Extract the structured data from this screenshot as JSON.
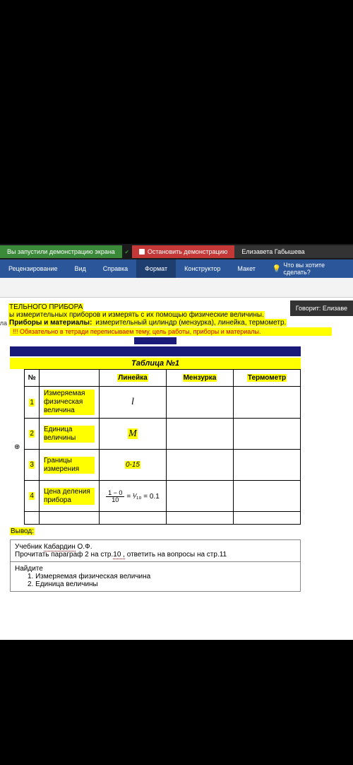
{
  "screenShare": {
    "running": "Вы запустили демонстрацию экрана",
    "stop": "Остановить демонстрацию",
    "user": "Елизавета Габышева"
  },
  "ribbon": {
    "review": "Рецензирование",
    "view": "Вид",
    "help": "Справка",
    "format": "Формат",
    "designer": "Конструктор",
    "layout": "Макет",
    "tellme": "Что вы хотите сделать?"
  },
  "speaking": "Говорит: Елизаве",
  "doc": {
    "partialTitle": "ТЕЛЬНОГО ПРИБОРА",
    "goalLine": "ы измерительных приборов и измерять с их помощью физические величины.",
    "sideFormula": "ула",
    "instrumentsLabel": "Приборы и материалы:",
    "instrumentsText": " измерительный цилиндр (мензурка), линейка, термометр.",
    "redNote": "!!! Обязательно в тетради переписываем тему, цель работы, приборы и материалы.",
    "tableTitle": "Таблица №1",
    "headers": {
      "num": "№",
      "blank": "",
      "ruler": "Линейка",
      "beaker": "Мензурка",
      "thermo": "Термометр"
    },
    "rows": [
      {
        "n": "1",
        "label": "Измеряемая физическая величина",
        "ruler": "l"
      },
      {
        "n": "2",
        "label": "Единица величины",
        "ruler": "М"
      },
      {
        "n": "3",
        "label": "Границы измерения",
        "ruler": "0-15"
      },
      {
        "n": "4",
        "label": "Цена деления прибора",
        "ruler_frac_top": "1 − 0",
        "ruler_frac_bot": "10",
        "ruler_eq": "= ¹⁄₁₀ = 0.1"
      }
    ],
    "vyvod": "Вывод:",
    "hw": {
      "line1a": "Учебник ",
      "line1b": "Кабардин",
      "line1c": " О.Ф.",
      "line2a": "Прочитать параграф 2 на стр.",
      "line2b": "10 ,",
      "line2c": " ответить на вопросы на стр.11",
      "line3": "Найдите",
      "li1": "1.   Измеряемая физическая величина",
      "li2": "2.   Единица величины"
    }
  }
}
